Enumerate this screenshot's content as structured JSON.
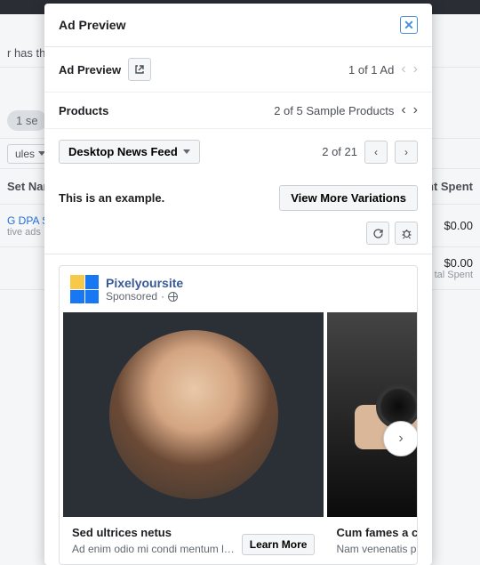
{
  "bg": {
    "row1_text": "r has the m",
    "pill": "1 se",
    "rules_btn": "ules",
    "col1": "Set Name",
    "col2": "nt Spent",
    "link1": "G DPA SHO",
    "link1_sub": "tive ads",
    "amt1": "$0.00",
    "amt2": "$0.00",
    "amt2_sub": "tal Spent"
  },
  "modal": {
    "title": "Ad Preview",
    "section_preview": {
      "label": "Ad Preview",
      "counter": "1 of 1 Ad"
    },
    "section_products": {
      "label": "Products",
      "counter": "2 of 5 Sample Products"
    },
    "section_format": {
      "dropdown": "Desktop News Feed",
      "counter": "2 of 21"
    },
    "example_text": "This is an example.",
    "variations_btn": "View More Variations"
  },
  "ad": {
    "page_name": "Pixelyoursite",
    "sponsored": "Sponsored",
    "items": [
      {
        "title": "Sed ultrices netus",
        "subtitle": "Ad enim odio mi condi mentum l…",
        "cta": "Learn More"
      },
      {
        "title": "Cum fames a cras dictumst",
        "subtitle": "Nam venenatis parturient conv"
      }
    ]
  }
}
